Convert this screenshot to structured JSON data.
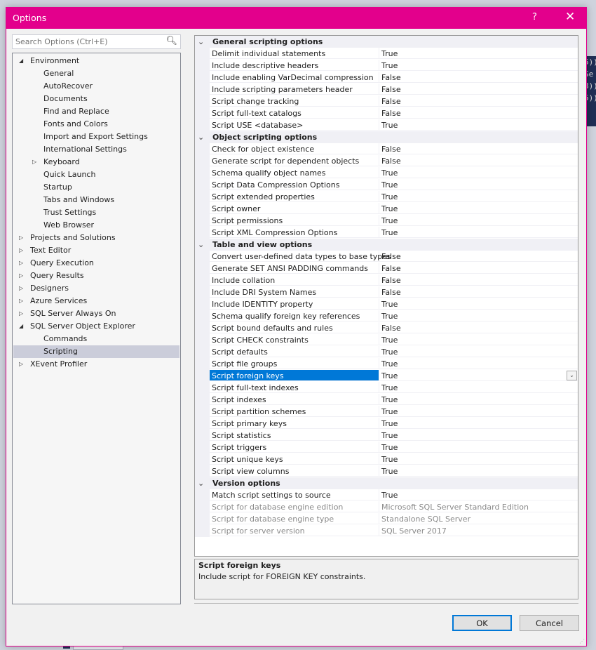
{
  "dialog": {
    "title": "Options",
    "help_label": "?",
    "close_label": "✕",
    "accent_color": "#e3008c"
  },
  "search": {
    "placeholder": "Search Options (Ctrl+E)",
    "icon": "search-icon"
  },
  "tree": {
    "items": [
      {
        "label": "Environment",
        "level": 0,
        "expander": "expanded"
      },
      {
        "label": "General",
        "level": 1,
        "expander": "none"
      },
      {
        "label": "AutoRecover",
        "level": 1,
        "expander": "none"
      },
      {
        "label": "Documents",
        "level": 1,
        "expander": "none"
      },
      {
        "label": "Find and Replace",
        "level": 1,
        "expander": "none"
      },
      {
        "label": "Fonts and Colors",
        "level": 1,
        "expander": "none"
      },
      {
        "label": "Import and Export Settings",
        "level": 1,
        "expander": "none"
      },
      {
        "label": "International Settings",
        "level": 1,
        "expander": "none"
      },
      {
        "label": "Keyboard",
        "level": 1,
        "expander": "collapsed"
      },
      {
        "label": "Quick Launch",
        "level": 1,
        "expander": "none"
      },
      {
        "label": "Startup",
        "level": 1,
        "expander": "none"
      },
      {
        "label": "Tabs and Windows",
        "level": 1,
        "expander": "none"
      },
      {
        "label": "Trust Settings",
        "level": 1,
        "expander": "none"
      },
      {
        "label": "Web Browser",
        "level": 1,
        "expander": "none"
      },
      {
        "label": "Projects and Solutions",
        "level": 0,
        "expander": "collapsed"
      },
      {
        "label": "Text Editor",
        "level": 0,
        "expander": "collapsed"
      },
      {
        "label": "Query Execution",
        "level": 0,
        "expander": "collapsed"
      },
      {
        "label": "Query Results",
        "level": 0,
        "expander": "collapsed"
      },
      {
        "label": "Designers",
        "level": 0,
        "expander": "collapsed"
      },
      {
        "label": "Azure Services",
        "level": 0,
        "expander": "collapsed"
      },
      {
        "label": "SQL Server Always On",
        "level": 0,
        "expander": "collapsed"
      },
      {
        "label": "SQL Server Object Explorer",
        "level": 0,
        "expander": "expanded"
      },
      {
        "label": "Commands",
        "level": 1,
        "expander": "none"
      },
      {
        "label": "Scripting",
        "level": 1,
        "expander": "none",
        "selected": true
      },
      {
        "label": "XEvent Profiler",
        "level": 0,
        "expander": "collapsed"
      }
    ]
  },
  "grid": {
    "categories": [
      {
        "label": "General scripting options",
        "properties": [
          {
            "name": "Delimit individual statements",
            "value": "True"
          },
          {
            "name": "Include descriptive headers",
            "value": "True"
          },
          {
            "name": "Include enabling VarDecimal compression",
            "value": "False"
          },
          {
            "name": "Include scripting parameters header",
            "value": "False"
          },
          {
            "name": "Script change tracking",
            "value": "False"
          },
          {
            "name": "Script full-text catalogs",
            "value": "False"
          },
          {
            "name": "Script USE <database>",
            "value": "True"
          }
        ]
      },
      {
        "label": "Object scripting options",
        "properties": [
          {
            "name": "Check for object existence",
            "value": "False"
          },
          {
            "name": "Generate script for dependent objects",
            "value": "False"
          },
          {
            "name": "Schema qualify object names",
            "value": "True"
          },
          {
            "name": "Script Data Compression Options",
            "value": "True"
          },
          {
            "name": "Script extended properties",
            "value": "True"
          },
          {
            "name": "Script owner",
            "value": "True"
          },
          {
            "name": "Script permissions",
            "value": "True"
          },
          {
            "name": "Script XML Compression Options",
            "value": "True"
          }
        ]
      },
      {
        "label": "Table and view options",
        "properties": [
          {
            "name": "Convert user-defined data types to base types",
            "value": "False"
          },
          {
            "name": "Generate SET ANSI PADDING commands",
            "value": "False"
          },
          {
            "name": "Include collation",
            "value": "False"
          },
          {
            "name": "Include DRI System Names",
            "value": "False"
          },
          {
            "name": "Include IDENTITY property",
            "value": "True"
          },
          {
            "name": "Schema qualify foreign key references",
            "value": "True"
          },
          {
            "name": "Script bound defaults and rules",
            "value": "False"
          },
          {
            "name": "Script CHECK constraints",
            "value": "True"
          },
          {
            "name": "Script defaults",
            "value": "True"
          },
          {
            "name": "Script file groups",
            "value": "True"
          },
          {
            "name": "Script foreign keys",
            "value": "True",
            "selected": true
          },
          {
            "name": "Script full-text indexes",
            "value": "True"
          },
          {
            "name": "Script indexes",
            "value": "True"
          },
          {
            "name": "Script partition schemes",
            "value": "True"
          },
          {
            "name": "Script primary keys",
            "value": "True"
          },
          {
            "name": "Script statistics",
            "value": "True"
          },
          {
            "name": "Script triggers",
            "value": "True"
          },
          {
            "name": "Script unique keys",
            "value": "True"
          },
          {
            "name": "Script view columns",
            "value": "True"
          }
        ]
      },
      {
        "label": "Version options",
        "properties": [
          {
            "name": "Match script settings to source",
            "value": "True"
          },
          {
            "name": "Script for database engine edition",
            "value": "Microsoft SQL Server Standard Edition",
            "disabled": true
          },
          {
            "name": "Script for database engine type",
            "value": "Standalone SQL Server",
            "disabled": true
          },
          {
            "name": "Script for server version",
            "value": "SQL Server 2017",
            "disabled": true
          }
        ]
      }
    ]
  },
  "description": {
    "title": "Script foreign keys",
    "text": "Include script for FOREIGN KEY constraints."
  },
  "buttons": {
    "ok": "OK",
    "cancel": "Cancel"
  },
  "background": {
    "code_fragments": [
      "5))",
      "Se",
      "8))",
      "5))"
    ]
  }
}
